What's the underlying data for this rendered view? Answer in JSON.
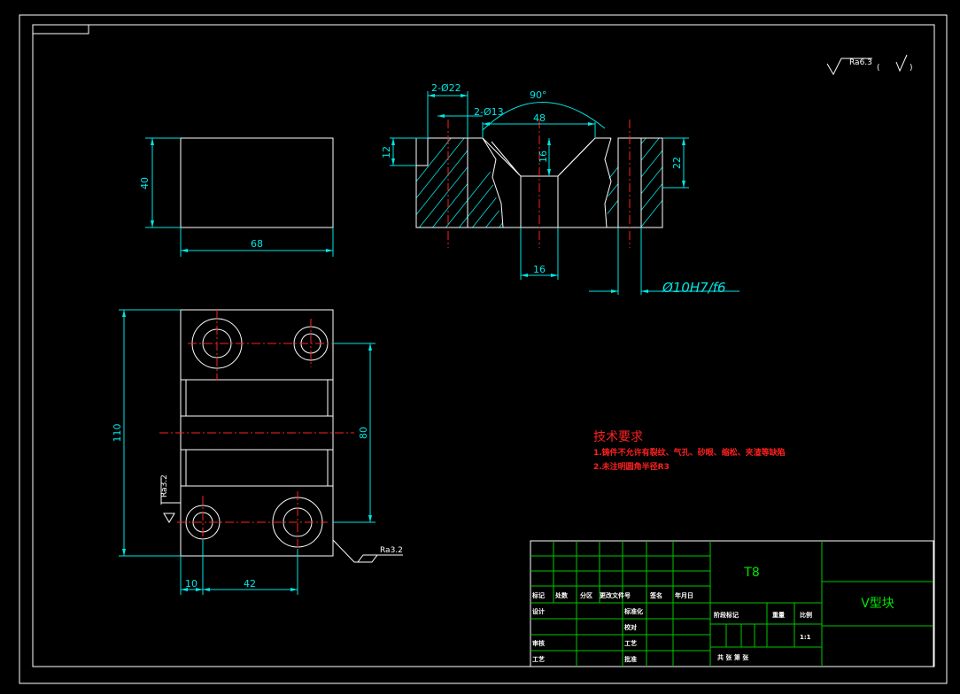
{
  "drawing": {
    "dimensions": {
      "front_height": "40",
      "front_width": "68",
      "hole_big": "2-Ø22",
      "hole_small": "2-Ø13",
      "v_angle": "90°",
      "v_width": "48",
      "counterbore_depth": "12",
      "v_depth": "16",
      "total_height": "22",
      "slot_width": "16",
      "shaft_fit": "Ø10H7/f6",
      "top_height": "110",
      "hole_spacing_v": "80",
      "edge_offset": "10",
      "hole_spacing_h": "42"
    },
    "roughness": {
      "general": "Ra6.3",
      "side": "Ra3.2",
      "bottom": "Ra3.2"
    },
    "technical_requirements": {
      "title": "技术要求",
      "items": [
        "1.铸件不允许有裂纹、气孔、砂眼、缩松、夹渣等缺陷",
        "2.未注明圆角半径R3"
      ]
    },
    "title_block": {
      "material": "T8",
      "part_name": "V型块",
      "scale": "1:1",
      "labels": {
        "mark": "标记",
        "count": "处数",
        "zone": "分区",
        "change_doc": "更改文件号",
        "signature": "签名",
        "date": "年月日",
        "design": "设计",
        "standardization": "标准化",
        "proofread": "校对",
        "review": "审核",
        "process_design": "工艺",
        "approve": "批准",
        "stage_mark": "阶段标记",
        "weight": "重量",
        "ratio": "比例",
        "sheet_info": "共  张  第  张"
      }
    }
  }
}
